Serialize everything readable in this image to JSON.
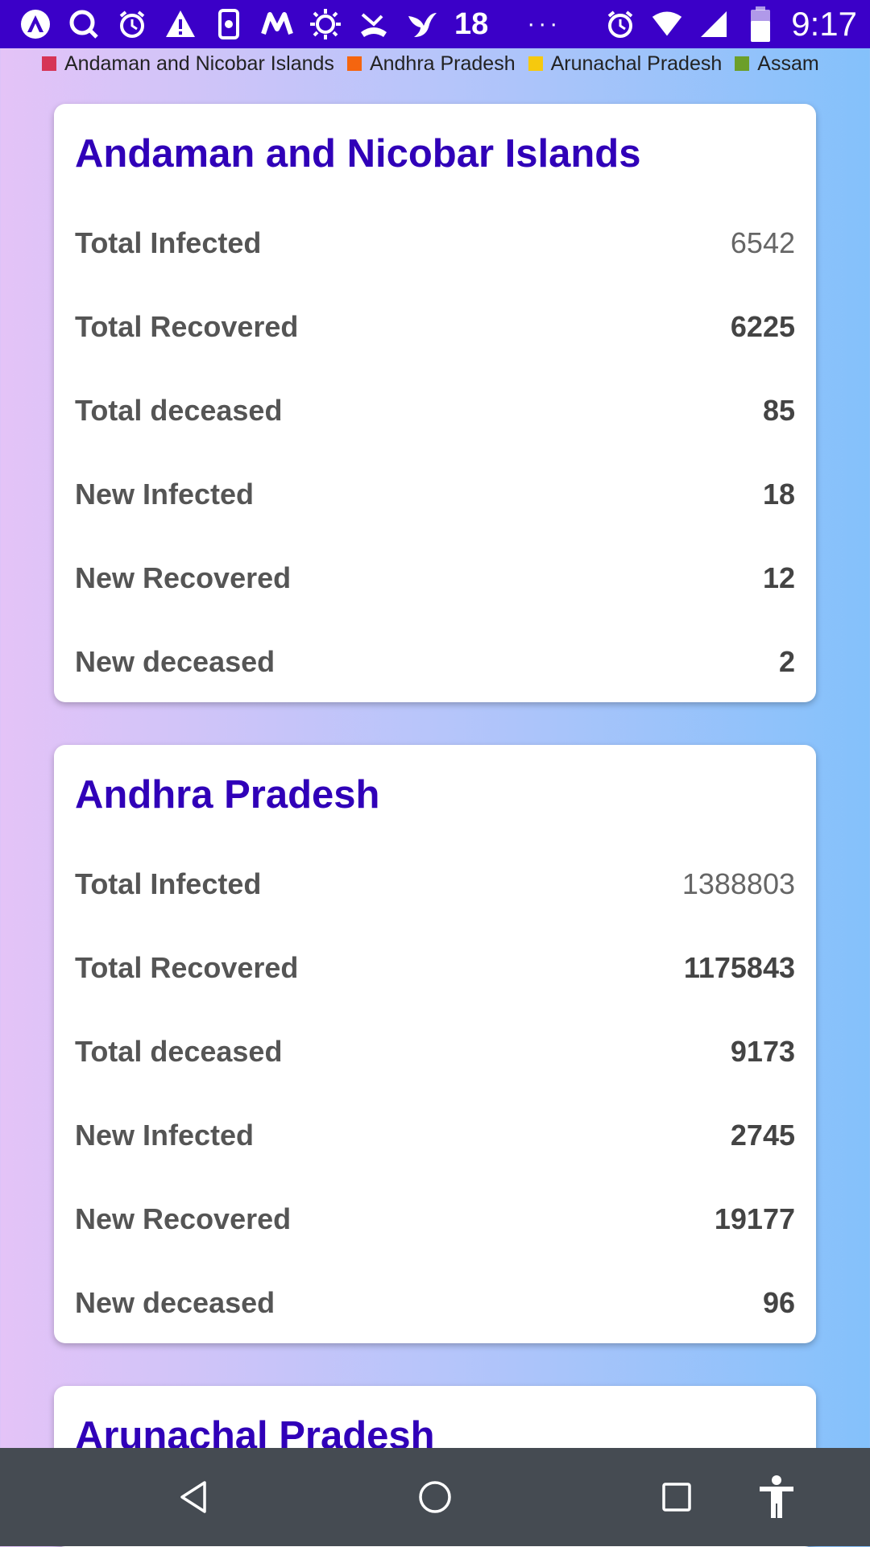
{
  "status_bar": {
    "left_icons": [
      "arch-icon",
      "search-icon",
      "alarm-icon",
      "warning-icon",
      "phone-settings-icon",
      "myntra-icon",
      "sun-icon",
      "phone-missed-icon",
      "bird-icon"
    ],
    "notification_count": "18",
    "more": "···",
    "time": "9:17"
  },
  "legend": {
    "items": [
      {
        "label": "Andaman and Nicobar Islands",
        "color": "#d63456"
      },
      {
        "label": "Andhra Pradesh",
        "color": "#f5650f"
      },
      {
        "label": "Arunachal Pradesh",
        "color": "#f6c90e"
      },
      {
        "label": "Assam",
        "color": "#6c9f2a"
      }
    ]
  },
  "cards": [
    {
      "title": "Andaman and Nicobar Islands",
      "rows": [
        {
          "label": "Total Infected",
          "value": "6542"
        },
        {
          "label": "Total Recovered",
          "value": "6225"
        },
        {
          "label": "Total deceased",
          "value": "85"
        },
        {
          "label": "New Infected",
          "value": "18"
        },
        {
          "label": "New Recovered",
          "value": "12"
        },
        {
          "label": "New deceased",
          "value": "2"
        }
      ]
    },
    {
      "title": "Andhra Pradesh",
      "rows": [
        {
          "label": "Total Infected",
          "value": "1388803"
        },
        {
          "label": "Total Recovered",
          "value": "1175843"
        },
        {
          "label": "Total deceased",
          "value": "9173"
        },
        {
          "label": "New Infected",
          "value": "2745"
        },
        {
          "label": "New Recovered",
          "value": "19177"
        },
        {
          "label": "New deceased",
          "value": "96"
        }
      ]
    },
    {
      "title": "Arunachal Pradesh"
    }
  ],
  "nav": [
    "back-icon",
    "home-icon",
    "recents-icon",
    "accessibility-icon"
  ]
}
